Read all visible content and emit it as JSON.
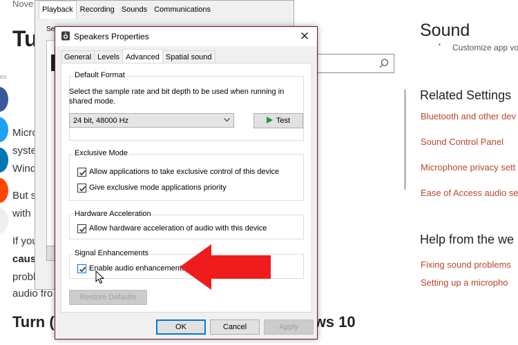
{
  "article": {
    "date": "Nove",
    "title": "Tu",
    "side_label": "es",
    "lines": [
      {
        "html_key": "l1",
        "text": "Micro"
      },
      {
        "html_key": "l2",
        "text": "syste"
      },
      {
        "html_key": "l3",
        "text": "Wind"
      },
      {
        "html_key": "l4",
        "text": "But s"
      },
      {
        "html_key": "l5",
        "text": "with"
      },
      {
        "html_key": "l6",
        "text": "If you"
      },
      {
        "html_key": "l7",
        "text": "caus"
      },
      {
        "html_key": "l8",
        "text": "probl"
      },
      {
        "html_key": "l9",
        "text": "audio fro"
      }
    ],
    "heading2_left": "Turn (",
    "heading2_right": "ws 10",
    "share_colors": [
      "#3b5998",
      "#1da1f2",
      "#0077b5",
      "#ff4500",
      "#eeeeee"
    ]
  },
  "settings": {
    "title": "Sound",
    "subtitle": "Customize app vo",
    "related_heading": "Related Settings",
    "related_links": [
      "Bluetooth and other dev",
      "Sound Control Panel",
      "Microphone privacy sett",
      "Ease of Access audio set"
    ],
    "help_heading": "Help from the we",
    "help_links": [
      "Fixing sound problems",
      "Setting up a micropho"
    ]
  },
  "sound_dialog": {
    "tabs": [
      "Playback",
      "Recording",
      "Sounds",
      "Communications"
    ],
    "active_tab": "Playback",
    "truncated_label": "Se"
  },
  "dialog": {
    "title": "Speakers Properties",
    "tabs": [
      "General",
      "Levels",
      "Advanced",
      "Spatial sound"
    ],
    "active_tab": "Advanced",
    "default_format": {
      "title": "Default Format",
      "description": "Select the sample rate and bit depth to be used when running in shared mode.",
      "selected": "24 bit, 48000 Hz",
      "test_label": "Test"
    },
    "exclusive_mode": {
      "title": "Exclusive Mode",
      "option1": "Allow applications to take exclusive control of this device",
      "option2": "Give exclusive mode applications priority"
    },
    "hardware": {
      "title": "Hardware Acceleration",
      "option1": "Allow hardware acceleration of audio with this device"
    },
    "signal": {
      "title": "Signal Enhancements",
      "option1": "Enable audio enhancements"
    },
    "restore_label": "Restore Defaults",
    "ok_label": "OK",
    "cancel_label": "Cancel",
    "apply_label": "Apply"
  },
  "colors": {
    "accent_red": "#ee1c1c",
    "link_orange": "#b7472a",
    "dialog_border": "#6d1212"
  }
}
